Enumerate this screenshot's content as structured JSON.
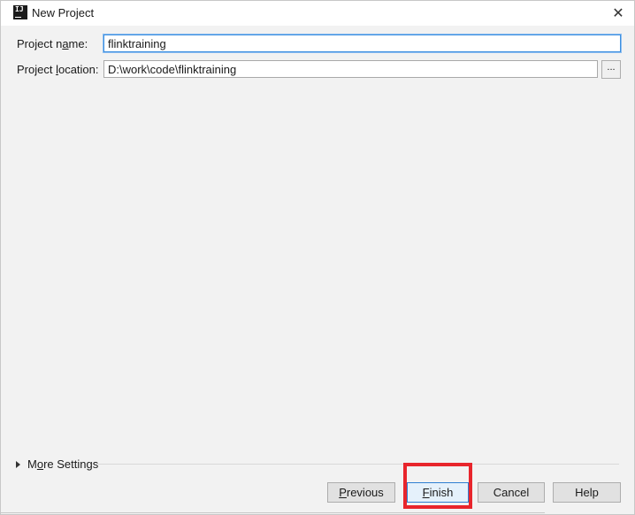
{
  "window": {
    "title": "New Project",
    "app_icon_text": "IJ"
  },
  "form": {
    "project_name_label_prefix": "Project n",
    "project_name_label_mnemonic": "a",
    "project_name_label_suffix": "me:",
    "project_name_value": "flinktraining",
    "project_location_label_prefix": "Project ",
    "project_location_label_mnemonic": "l",
    "project_location_label_suffix": "ocation:",
    "project_location_value": "D:\\work\\code\\flinktraining",
    "browse_label": "..."
  },
  "more_settings": {
    "label_prefix": "M",
    "label_mnemonic": "o",
    "label_suffix": "re Settings"
  },
  "buttons": {
    "previous_mnemonic": "P",
    "previous_rest": "revious",
    "finish_mnemonic": "F",
    "finish_rest": "inish",
    "cancel": "Cancel",
    "help": "Help"
  },
  "colors": {
    "highlight": "#e8252c",
    "focus": "#3d8fe0"
  }
}
